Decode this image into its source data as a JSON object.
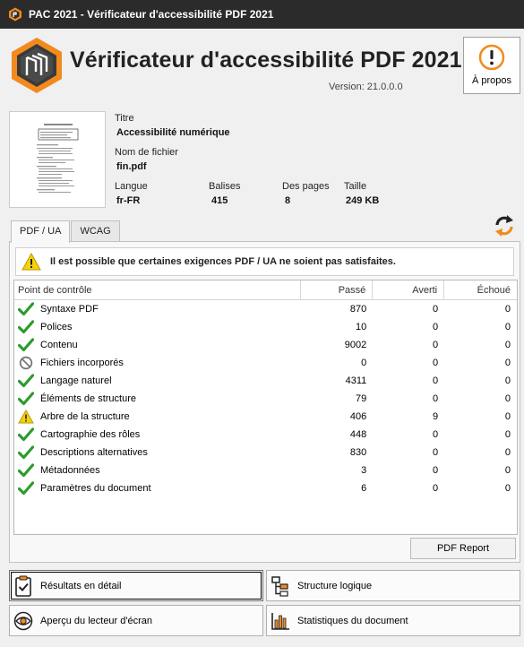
{
  "window": {
    "title": "PAC 2021 - Vérificateur d'accessibilité PDF 2021"
  },
  "header": {
    "app_title": "Vérificateur d'accessibilité PDF 2021",
    "version": "Version: 21.0.0.0",
    "about_label": "À propos"
  },
  "document": {
    "title_label": "Titre",
    "title_value": "Accessibilité numérique",
    "filename_label": "Nom de fichier",
    "filename_value": "fin.pdf",
    "language_label": "Langue",
    "language_value": "fr-FR",
    "tags_label": "Balises",
    "tags_value": "415",
    "pages_label": "Des pages",
    "pages_value": "8",
    "size_label": "Taille",
    "size_value": "249 KB"
  },
  "tabs": [
    {
      "label": "PDF / UA",
      "active": true
    },
    {
      "label": "WCAG",
      "active": false
    }
  ],
  "warning": {
    "message": "Il est possible que certaines exigences PDF / UA ne soient pas satisfaites."
  },
  "table": {
    "headers": [
      "Point de contrôle",
      "Passé",
      "Averti",
      "Échoué"
    ],
    "rows": [
      {
        "icon": "check-icon",
        "name": "Syntaxe PDF",
        "passed": "870",
        "warned": "0",
        "failed": "0"
      },
      {
        "icon": "check-icon",
        "name": "Polices",
        "passed": "10",
        "warned": "0",
        "failed": "0"
      },
      {
        "icon": "check-icon",
        "name": "Contenu",
        "passed": "9002",
        "warned": "0",
        "failed": "0"
      },
      {
        "icon": "not-applicable-icon",
        "name": "Fichiers incorporés",
        "passed": "0",
        "warned": "0",
        "failed": "0"
      },
      {
        "icon": "check-icon",
        "name": "Langage naturel",
        "passed": "4311",
        "warned": "0",
        "failed": "0"
      },
      {
        "icon": "check-icon",
        "name": "Éléments de structure",
        "passed": "79",
        "warned": "0",
        "failed": "0"
      },
      {
        "icon": "warning-icon",
        "name": "Arbre de la structure",
        "passed": "406",
        "warned": "9",
        "failed": "0"
      },
      {
        "icon": "check-icon",
        "name": "Cartographie des rôles",
        "passed": "448",
        "warned": "0",
        "failed": "0"
      },
      {
        "icon": "check-icon",
        "name": "Descriptions alternatives",
        "passed": "830",
        "warned": "0",
        "failed": "0"
      },
      {
        "icon": "check-icon",
        "name": "Métadonnées",
        "passed": "3",
        "warned": "0",
        "failed": "0"
      },
      {
        "icon": "check-icon",
        "name": "Paramètres du document",
        "passed": "6",
        "warned": "0",
        "failed": "0"
      }
    ]
  },
  "buttons": {
    "pdf_report": "PDF Report",
    "detailed_results": "Résultats en détail",
    "logical_structure": "Structure logique",
    "screen_reader_preview": "Aperçu du lecteur d'écran",
    "document_statistics": "Statistiques du document"
  },
  "colors": {
    "accent_orange": "#f28a1e",
    "check_green": "#2e9b2e",
    "warning_yellow": "#f5d20a"
  }
}
